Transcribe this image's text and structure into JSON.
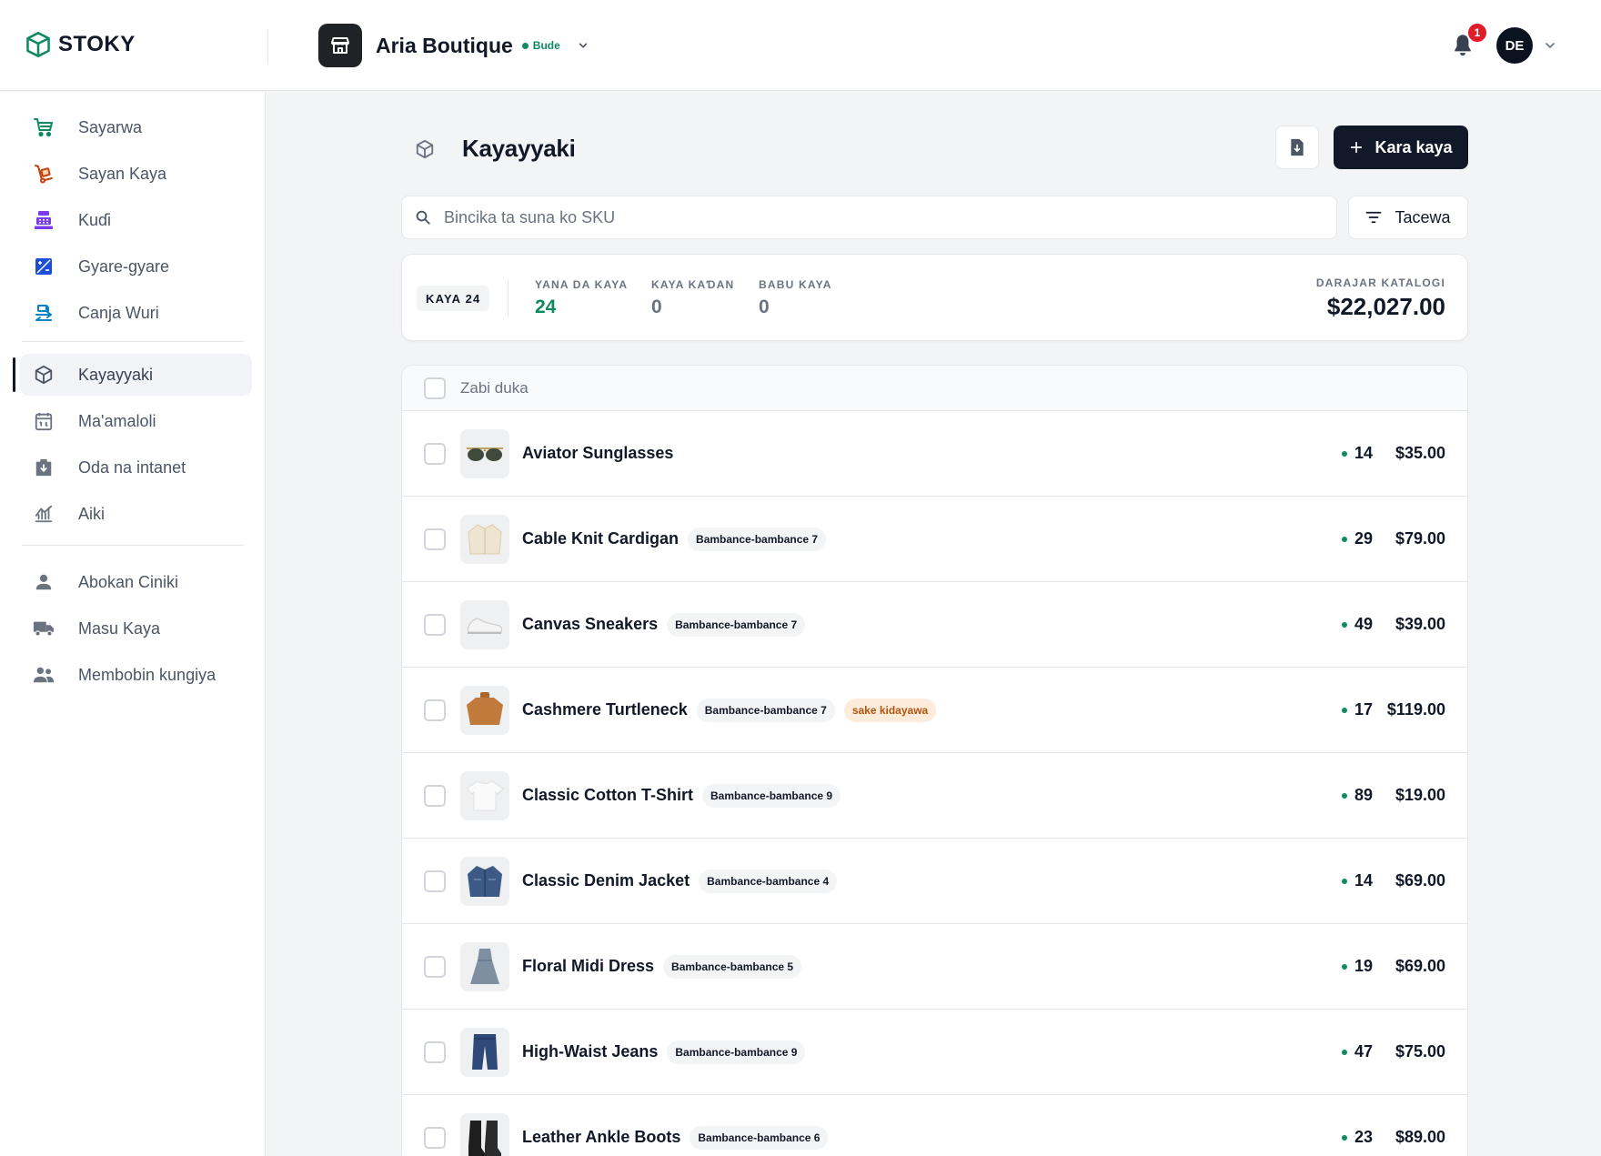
{
  "brand": {
    "name": "STOKY",
    "accent": "#0f8a5f"
  },
  "store": {
    "name": "Aria Boutique",
    "status": "Bude",
    "icon": "storefront-icon"
  },
  "header": {
    "notification_count": "1",
    "user_initials": "DE"
  },
  "sidebar": {
    "groups": [
      [
        {
          "label": "Sayarwa",
          "icon": "cart-icon",
          "color": "#0f8a5f"
        },
        {
          "label": "Sayan Kaya",
          "icon": "dolly-icon",
          "color": "#c2410c"
        },
        {
          "label": "Kuɗi",
          "icon": "cash-register-icon",
          "color": "#7c3aed"
        },
        {
          "label": "Gyare-gyare",
          "icon": "adjust-icon",
          "color": "#1d4ed8"
        },
        {
          "label": "Canja Wuri",
          "icon": "transfer-icon",
          "color": "#0284c7"
        }
      ],
      [
        {
          "label": "Kayayyaki",
          "icon": "cube-icon",
          "active": true
        },
        {
          "label": "Ma'amaloli",
          "icon": "calendar-icon"
        },
        {
          "label": "Oda na intanet",
          "icon": "download-box-icon"
        },
        {
          "label": "Aiki",
          "icon": "chart-icon"
        }
      ],
      [
        {
          "label": "Abokan Ciniki",
          "icon": "person-icon"
        },
        {
          "label": "Masu Kaya",
          "icon": "truck-icon"
        },
        {
          "label": "Membobin kungiya",
          "icon": "group-icon"
        }
      ]
    ]
  },
  "page": {
    "title": "Kayayyaki",
    "add_label": "Kara kaya",
    "search_placeholder": "Bincika ta suna ko SKU",
    "filter_label": "Tacewa"
  },
  "stats": {
    "count_label": "KAYA 24",
    "items": [
      {
        "label": "YANA DA KAYA",
        "value": "24",
        "color": "green"
      },
      {
        "label": "KAYA KAƊAN",
        "value": "0"
      },
      {
        "label": "BABU KAYA",
        "value": "0"
      }
    ],
    "total_label": "DARAJAR KATALOGI",
    "total_value": "$22,027.00"
  },
  "table": {
    "select_all_label": "Zabi duka",
    "rows": [
      {
        "name": "Aviator Sunglasses",
        "tags": [],
        "stock": "14",
        "price": "$35.00",
        "thumb": "sunglasses"
      },
      {
        "name": "Cable Knit Cardigan",
        "tags": [
          "Bambance-bambance 7"
        ],
        "stock": "29",
        "price": "$79.00",
        "thumb": "cardigan"
      },
      {
        "name": "Canvas Sneakers",
        "tags": [
          "Bambance-bambance 7"
        ],
        "stock": "49",
        "price": "$39.00",
        "thumb": "sneakers"
      },
      {
        "name": "Cashmere Turtleneck",
        "tags": [
          "Bambance-bambance 7"
        ],
        "warn": "sake kidayawa",
        "stock": "17",
        "price": "$119.00",
        "thumb": "turtleneck"
      },
      {
        "name": "Classic Cotton T-Shirt",
        "tags": [
          "Bambance-bambance 9"
        ],
        "stock": "89",
        "price": "$19.00",
        "thumb": "tshirt"
      },
      {
        "name": "Classic Denim Jacket",
        "tags": [
          "Bambance-bambance 4"
        ],
        "stock": "14",
        "price": "$69.00",
        "thumb": "jacket"
      },
      {
        "name": "Floral Midi Dress",
        "tags": [
          "Bambance-bambance 5"
        ],
        "stock": "19",
        "price": "$69.00",
        "thumb": "dress"
      },
      {
        "name": "High-Waist Jeans",
        "tags": [
          "Bambance-bambance 9"
        ],
        "stock": "47",
        "price": "$75.00",
        "thumb": "jeans"
      },
      {
        "name": "Leather Ankle Boots",
        "tags": [
          "Bambance-bambance 6"
        ],
        "stock": "23",
        "price": "$89.00",
        "thumb": "boots"
      }
    ]
  }
}
